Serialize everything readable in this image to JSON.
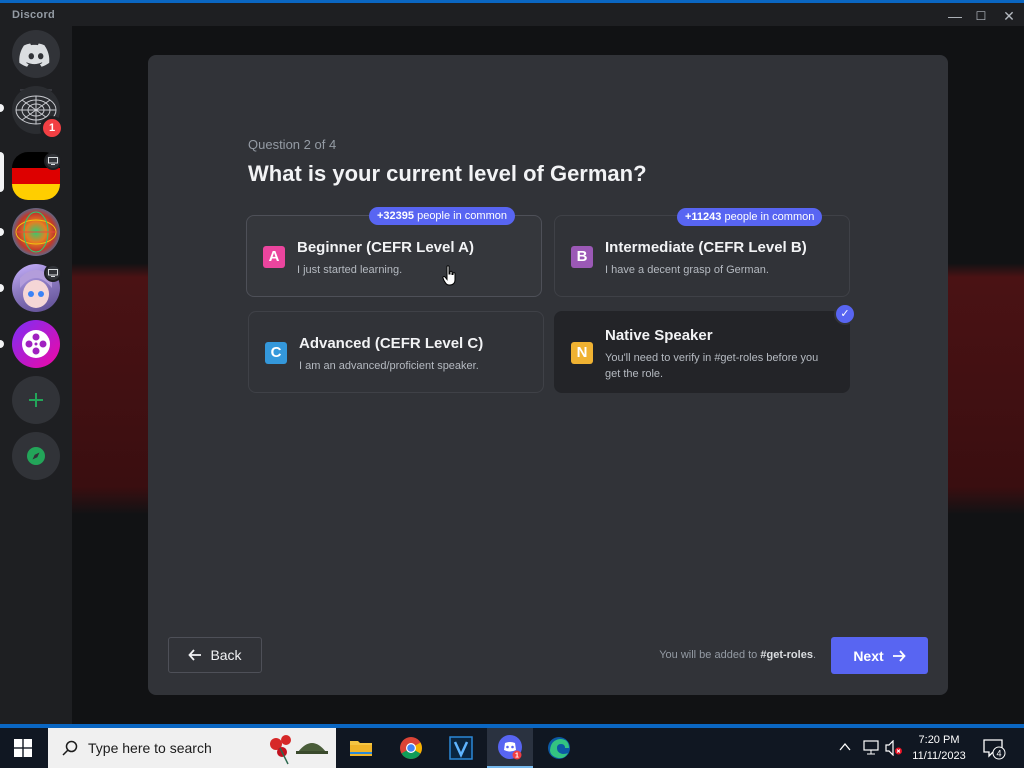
{
  "window": {
    "title": "Discord",
    "controls": {
      "minimize": "—",
      "maximize": "☐",
      "close": "✕"
    }
  },
  "servers": [
    {
      "name": "home",
      "icon": "discord-logo-icon"
    },
    {
      "name": "server-wireframe",
      "badge": "1"
    },
    {
      "name": "server-germany",
      "active": true
    },
    {
      "name": "server-colorful-sphere"
    },
    {
      "name": "server-anime-avatar"
    },
    {
      "name": "server-film-reel"
    },
    {
      "name": "add-server",
      "icon": "plus-icon"
    },
    {
      "name": "explore",
      "icon": "compass-icon"
    }
  ],
  "modal": {
    "question_count": "Question 2 of 4",
    "question_title": "What is your current level of German?",
    "options": [
      {
        "letter": "A",
        "title": "Beginner (CEFR Level A)",
        "desc": "I just started learning.",
        "common_count": "+32395",
        "common_text": "people in common",
        "color": "#eb459e"
      },
      {
        "letter": "B",
        "title": "Intermediate (CEFR Level B)",
        "desc": "I have a decent grasp of German.",
        "common_count": "+11243",
        "common_text": "people in common",
        "color": "#9b59b6"
      },
      {
        "letter": "C",
        "title": "Advanced (CEFR Level C)",
        "desc": "I am an advanced/proficient speaker.",
        "color": "#3498db"
      },
      {
        "letter": "N",
        "title": "Native Speaker",
        "desc": "You'll need to verify in #get-roles before you get the role.",
        "color": "#f0b232",
        "selected": true
      }
    ],
    "back_label": "Back",
    "footer_note_prefix": "You will be added to",
    "footer_note_channel": "#get-roles",
    "footer_note_suffix": ".",
    "next_label": "Next",
    "accent": "#5865f2"
  },
  "taskbar": {
    "search_placeholder": "Type here to search",
    "time": "7:20 PM",
    "date": "11/11/2023",
    "notification_count": "4",
    "discord_badge": "1"
  }
}
